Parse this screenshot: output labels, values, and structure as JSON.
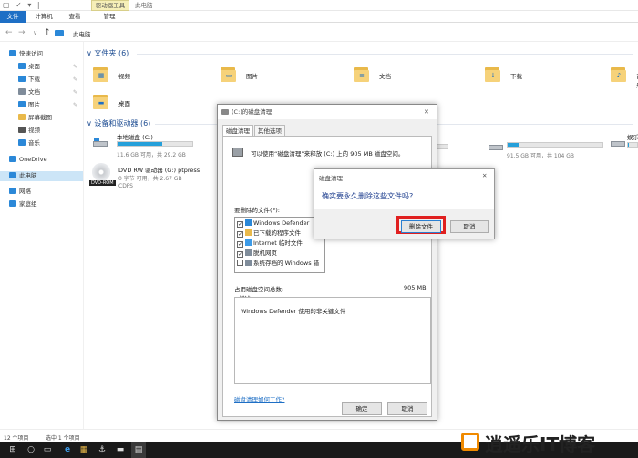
{
  "titlebar": {
    "quick_access": "▢ ✓ ▾ |",
    "context_tab": "驱动器工具",
    "window_title": "此电脑"
  },
  "ribbon": {
    "tabs": [
      "文件",
      "计算机",
      "查看",
      "管理"
    ]
  },
  "address": {
    "back": "←",
    "forward": "→",
    "dropdown": "∨",
    "up": "↑",
    "path": "此电脑"
  },
  "sidebar": {
    "items": [
      {
        "label": "快速访问",
        "icon": "star-icon",
        "color": "#2b88d8",
        "pinned": false
      },
      {
        "label": "桌面",
        "icon": "desktop-icon",
        "color": "#2b88d8",
        "pinned": true
      },
      {
        "label": "下载",
        "icon": "download-icon",
        "color": "#2b88d8",
        "pinned": true
      },
      {
        "label": "文档",
        "icon": "document-icon",
        "color": "#7f8c9a",
        "pinned": true
      },
      {
        "label": "图片",
        "icon": "pictures-icon",
        "color": "#2b88d8",
        "pinned": true
      },
      {
        "label": "屏幕截图",
        "icon": "folder-icon",
        "color": "#e9b94a",
        "pinned": false
      },
      {
        "label": "视频",
        "icon": "video-icon",
        "color": "#555555",
        "pinned": false
      },
      {
        "label": "音乐",
        "icon": "music-icon",
        "color": "#2b88d8",
        "pinned": false
      },
      {
        "label": "OneDrive",
        "icon": "onedrive-icon",
        "color": "#2b88d8",
        "pinned": false
      },
      {
        "label": "此电脑",
        "icon": "computer-icon",
        "color": "#2b88d8",
        "pinned": false
      },
      {
        "label": "网络",
        "icon": "network-icon",
        "color": "#2b88d8",
        "pinned": false
      },
      {
        "label": "家庭组",
        "icon": "homegroup-icon",
        "color": "#2b88d8",
        "pinned": false
      }
    ],
    "pin_glyph": "✎"
  },
  "main": {
    "folders_header": "文件夹 (6)",
    "folders": [
      {
        "label": "视频",
        "icon": "video-folder-icon",
        "glyph": "▦"
      },
      {
        "label": "图片",
        "icon": "pictures-folder-icon",
        "glyph": "▭"
      },
      {
        "label": "文档",
        "icon": "documents-folder-icon",
        "glyph": "≡"
      },
      {
        "label": "下载",
        "icon": "downloads-folder-icon",
        "glyph": "↓"
      },
      {
        "label": "音乐",
        "icon": "music-folder-icon",
        "glyph": "♪"
      },
      {
        "label": "桌面",
        "icon": "desktop-folder-icon",
        "glyph": "▬"
      }
    ],
    "drives_header": "设备和驱动器 (6)",
    "drives": [
      {
        "name": "本地磁盘 (C:)",
        "free": "11.6 GB 可用，共 29.2 GB",
        "usage": 0.6
      },
      {
        "name": "",
        "free": "",
        "usage": 0.1
      },
      {
        "name": "",
        "free": "91.5 GB 可用，共 104 GB",
        "usage": 0.12
      },
      {
        "name": "娱乐 (F:)",
        "free": "",
        "usage": 0.12
      }
    ],
    "dvd": {
      "name": "DVD RW 驱动器 (G:) ptpress",
      "free": "0 字节 可用，共 2.67 GB",
      "fs": "CDFS",
      "badge": "DVD-ROM"
    }
  },
  "status": {
    "items": "12 个项目",
    "selected": "选中 1 个项目"
  },
  "taskbar": {
    "start": "⊞",
    "search": "○",
    "task_view": "▭",
    "apps": [
      "e",
      "▦",
      "⚓",
      "▬",
      "▤"
    ]
  },
  "cleanup": {
    "title": "(C:)的磁盘清理",
    "close": "✕",
    "tabs": [
      "磁盘清理",
      "其他选项"
    ],
    "intro": "可以使用“磁盘清理”来释放 (C:) 上的 905 MB 磁盘空间。",
    "files_label": "要删除的文件(F):",
    "files": [
      {
        "label": "Windows Defender",
        "checked": true
      },
      {
        "label": "已下载的程序文件",
        "checked": true
      },
      {
        "label": "Internet 临时文件",
        "checked": true
      },
      {
        "label": "脱机网页",
        "checked": true
      },
      {
        "label": "系统存档的 Windows 错",
        "checked": false
      }
    ],
    "sizes": [
      "",
      "",
      ""
    ],
    "total_label": "占用磁盘空间总数:",
    "total_value": "905 MB",
    "desc_label": "描述",
    "desc_text": "Windows Defender 使用的非关键文件",
    "how_link": "磁盘清理如何工作?",
    "ok": "确定",
    "cancel": "取消"
  },
  "confirm": {
    "title": "磁盘清理",
    "close": "✕",
    "question": "确实要永久删除这些文件吗?",
    "delete": "删除文件",
    "cancel": "取消",
    "highlight_color": "#e02020"
  },
  "watermark": {
    "text": "逍遥乐IT博客",
    "brand_color": "#f08a00"
  }
}
